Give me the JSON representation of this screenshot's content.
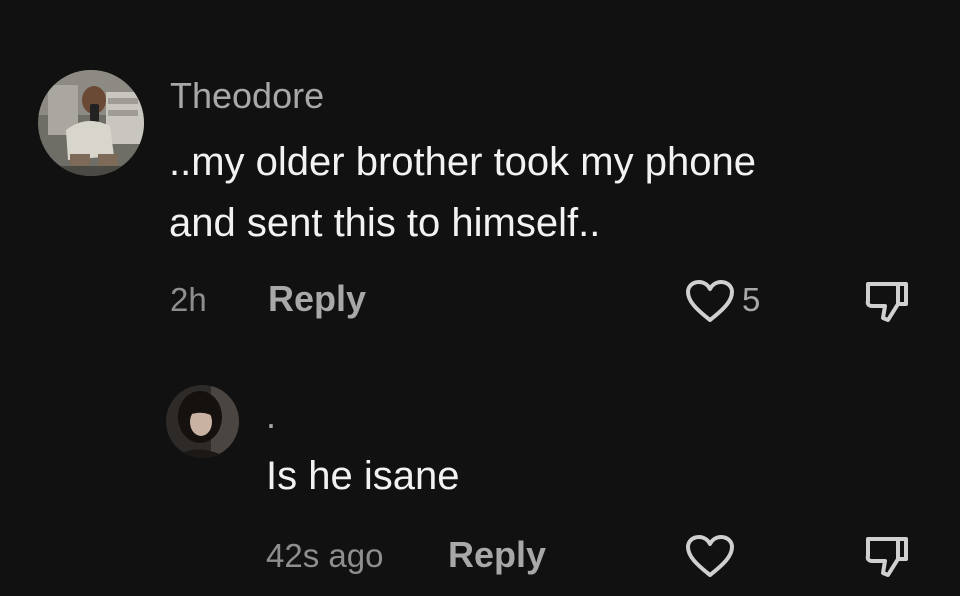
{
  "comments": [
    {
      "username": "Theodore",
      "text_lines": [
        "..my older brother took my phone",
        "and sent this to himself.."
      ],
      "time": "2h",
      "reply_label": "Reply",
      "like_count": "5",
      "avatar_icon": "user-avatar-photo",
      "like_icon": "heart-outline-icon",
      "dislike_icon": "thumbs-down-icon"
    },
    {
      "username": ".",
      "text_lines": [
        "Is he isane"
      ],
      "time": "42s ago",
      "reply_label": "Reply",
      "avatar_icon": "user-avatar-photo",
      "like_icon": "heart-outline-icon",
      "dislike_icon": "thumbs-down-icon"
    }
  ],
  "colors": {
    "background": "#111111",
    "primary_text": "#f2f2f2",
    "secondary_text": "#a8a8a8",
    "icon": "#d0d0d0"
  }
}
